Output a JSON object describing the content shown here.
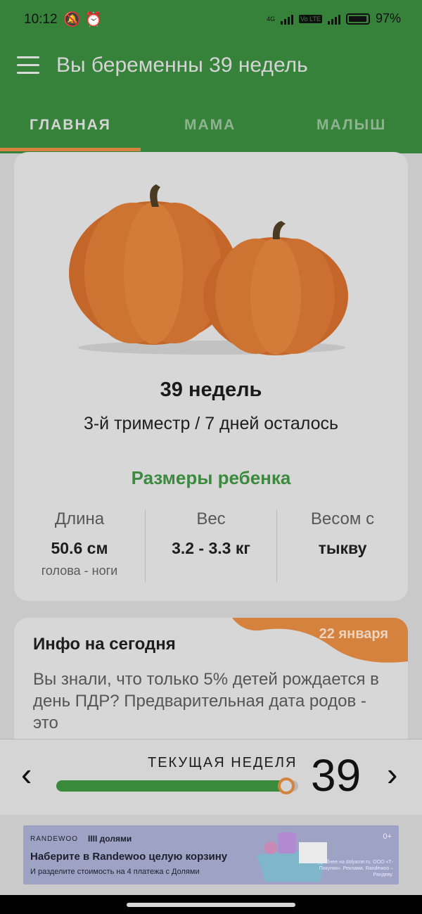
{
  "status_bar": {
    "time": "10:12",
    "battery": "97%",
    "net1": "4G",
    "net2": "Vo LTE"
  },
  "app_bar": {
    "title": "Вы беременны 39 недель"
  },
  "tabs": [
    {
      "label": "ГЛАВНАЯ",
      "active": true
    },
    {
      "label": "МАМА",
      "active": false
    },
    {
      "label": "МАЛЫШ",
      "active": false
    }
  ],
  "week_card": {
    "weeks": "39 недель",
    "trimester_text": "3-й триместр / 7 дней осталось",
    "sizes_title": "Размеры ребенка",
    "length_label": "Длина",
    "length_value": "50.6 см",
    "length_sub": "голова - ноги",
    "weight_label": "Вес",
    "weight_value": "3.2 - 3.3 кг",
    "compare_label": "Весом с",
    "compare_value": "тыкву"
  },
  "info_card": {
    "title": "Инфо на сегодня",
    "date": "22 января",
    "text": "Вы знали, что только 5% детей рождается в день ПДР? Предварительная дата родов - это"
  },
  "week_selector": {
    "label": "ТЕКУЩАЯ НЕДЕЛЯ",
    "number": "39",
    "progress": 0.95,
    "prev": "‹",
    "next": "›"
  },
  "ad": {
    "brand": "RANDEWOO",
    "partner": "IIII долями",
    "headline": "Наберите в Randewoo целую корзину",
    "subtext": "И разделите стоимость на 4 платежа с Долями",
    "age": "0+",
    "legal": "Подробнее на dolyame.ru. ООО «Т-Покупки». Реклама. Randewoo – Рандеву."
  },
  "colors": {
    "app_green": "#37823b",
    "accent_orange": "#d5823e",
    "title_green": "#3b8a3e"
  }
}
